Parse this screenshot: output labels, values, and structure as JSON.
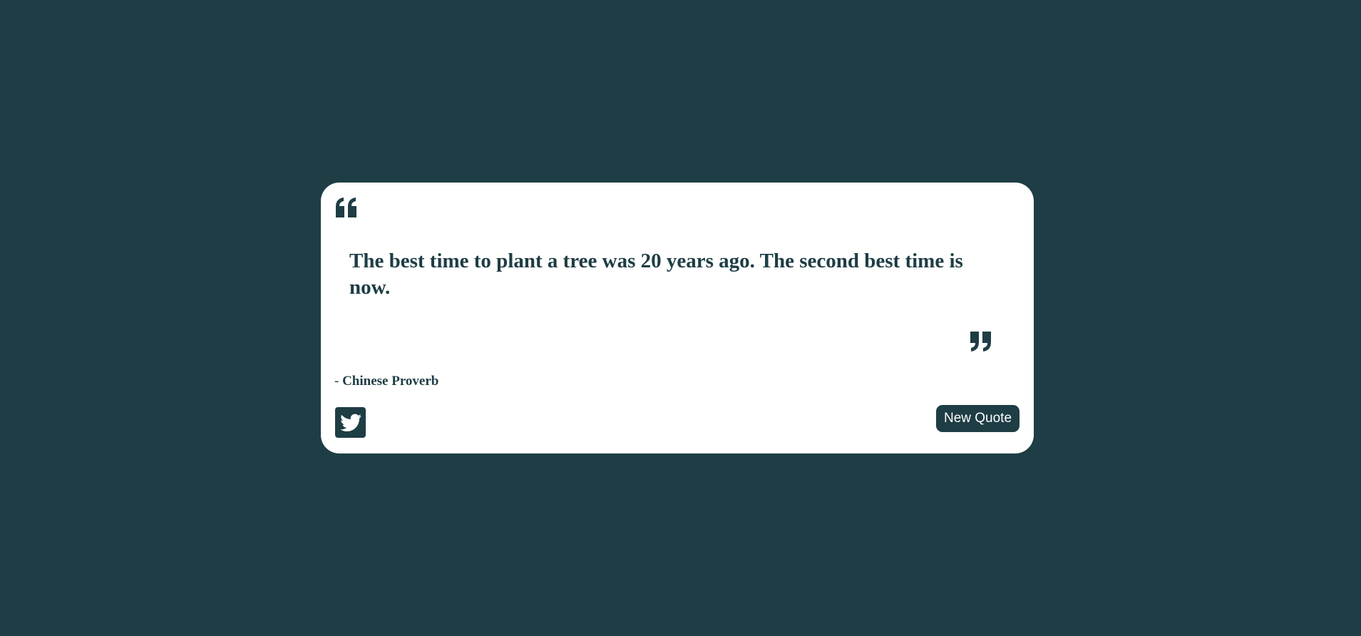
{
  "colors": {
    "background": "#1e3d44",
    "card": "#ffffff",
    "accent": "#1e3d44",
    "button_text": "#ffffff"
  },
  "quote": {
    "open_icon": "quote-left-icon",
    "close_icon": "quote-right-icon",
    "text": "The best time to plant a tree was 20 years ago. The second best time is now.",
    "author_prefix": "- ",
    "author": "Chinese Proverb"
  },
  "actions": {
    "tweet_icon": "twitter-icon",
    "new_quote_label": "New Quote"
  }
}
